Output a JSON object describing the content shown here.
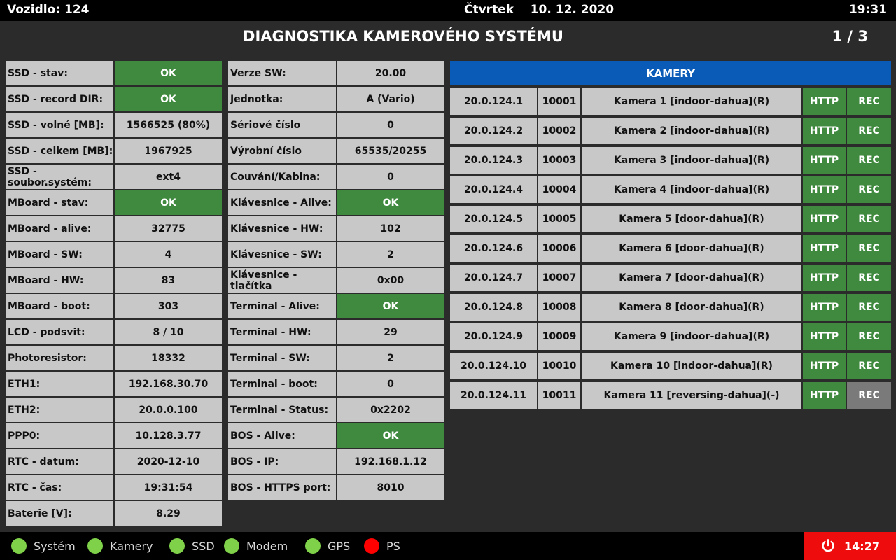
{
  "header": {
    "vehicle": "Vozidlo: 124",
    "day": "Čtvrtek",
    "date": "10. 12. 2020",
    "clock": "19:31"
  },
  "title": "DIAGNOSTIKA KAMEROVÉHO SYSTÉMU",
  "page": "1 / 3",
  "colors": {
    "ok": "#3f8a3f",
    "cell": "#c8c8c8",
    "header_blue": "#0a5bb8",
    "status_green": "#7fd14a",
    "status_red": "#ff0000",
    "power_red": "#ef0c0c",
    "rec_off": "#7a7a7a"
  },
  "col1": [
    {
      "label": "SSD - stav:",
      "value": "OK",
      "ok": true
    },
    {
      "label": "SSD - record DIR:",
      "value": "OK",
      "ok": true
    },
    {
      "label": "SSD - volné [MB]:",
      "value": "1566525 (80%)"
    },
    {
      "label": "SSD - celkem [MB]:",
      "value": "1967925"
    },
    {
      "label": "SSD - soubor.systém:",
      "value": "ext4"
    },
    {
      "label": "MBoard - stav:",
      "value": "OK",
      "ok": true
    },
    {
      "label": "MBoard - alive:",
      "value": "32775"
    },
    {
      "label": "MBoard - SW:",
      "value": "4"
    },
    {
      "label": "MBoard - HW:",
      "value": "83"
    },
    {
      "label": "MBoard - boot:",
      "value": "303"
    },
    {
      "label": "LCD - podsvit:",
      "value": "8 / 10"
    },
    {
      "label": "Photoresistor:",
      "value": "18332"
    },
    {
      "label": "ETH1:",
      "value": "192.168.30.70"
    },
    {
      "label": "ETH2:",
      "value": "20.0.0.100"
    },
    {
      "label": "PPP0:",
      "value": "10.128.3.77"
    },
    {
      "label": "RTC - datum:",
      "value": "2020-12-10"
    },
    {
      "label": "RTC - čas:",
      "value": "19:31:54"
    },
    {
      "label": "Baterie [V]:",
      "value": "8.29"
    }
  ],
  "col2": [
    {
      "label": "Verze SW:",
      "value": "20.00"
    },
    {
      "label": "Jednotka:",
      "value": "A (Vario)"
    },
    {
      "label": "Sériové číslo",
      "value": "0"
    },
    {
      "label": "Výrobní číslo",
      "value": "65535/20255"
    },
    {
      "label": "Couvání/Kabina:",
      "value": "0"
    },
    {
      "label": "Klávesnice - Alive:",
      "value": "OK",
      "ok": true
    },
    {
      "label": "Klávesnice - HW:",
      "value": "102"
    },
    {
      "label": "Klávesnice - SW:",
      "value": "2"
    },
    {
      "label": "Klávesnice - tlačítka",
      "value": "0x00"
    },
    {
      "label": "Terminal - Alive:",
      "value": "OK",
      "ok": true
    },
    {
      "label": "Terminal - HW:",
      "value": "29"
    },
    {
      "label": "Terminal - SW:",
      "value": "2"
    },
    {
      "label": "Terminal - boot:",
      "value": "0"
    },
    {
      "label": "Terminal - Status:",
      "value": "0x2202"
    },
    {
      "label": "BOS - Alive:",
      "value": "OK",
      "ok": true
    },
    {
      "label": "BOS - IP:",
      "value": "192.168.1.12"
    },
    {
      "label": "BOS - HTTPS port:",
      "value": "8010"
    }
  ],
  "cameras": {
    "header": "KAMERY",
    "http_label": "HTTP",
    "rec_label": "REC",
    "rows": [
      {
        "ip": "20.0.124.1",
        "port": "10001",
        "name": "Kamera 1 [indoor-dahua](R)",
        "rec_ok": true
      },
      {
        "ip": "20.0.124.2",
        "port": "10002",
        "name": "Kamera 2 [indoor-dahua](R)",
        "rec_ok": true
      },
      {
        "ip": "20.0.124.3",
        "port": "10003",
        "name": "Kamera 3 [indoor-dahua](R)",
        "rec_ok": true
      },
      {
        "ip": "20.0.124.4",
        "port": "10004",
        "name": "Kamera 4 [indoor-dahua](R)",
        "rec_ok": true
      },
      {
        "ip": "20.0.124.5",
        "port": "10005",
        "name": "Kamera 5 [door-dahua](R)",
        "rec_ok": true
      },
      {
        "ip": "20.0.124.6",
        "port": "10006",
        "name": "Kamera 6 [door-dahua](R)",
        "rec_ok": true
      },
      {
        "ip": "20.0.124.7",
        "port": "10007",
        "name": "Kamera 7 [door-dahua](R)",
        "rec_ok": true
      },
      {
        "ip": "20.0.124.8",
        "port": "10008",
        "name": "Kamera 8 [door-dahua](R)",
        "rec_ok": true
      },
      {
        "ip": "20.0.124.9",
        "port": "10009",
        "name": "Kamera 9 [indoor-dahua](R)",
        "rec_ok": true
      },
      {
        "ip": "20.0.124.10",
        "port": "10010",
        "name": "Kamera 10 [indoor-dahua](R)",
        "rec_ok": true
      },
      {
        "ip": "20.0.124.11",
        "port": "10011",
        "name": "Kamera 11 [reversing-dahua](-)",
        "rec_ok": false
      }
    ]
  },
  "status_bar": [
    {
      "label": "Systém",
      "state": "ok"
    },
    {
      "label": "Kamery",
      "state": "ok"
    },
    {
      "label": "SSD",
      "state": "ok"
    },
    {
      "label": "Modem",
      "state": "ok"
    },
    {
      "label": "GPS",
      "state": "ok"
    },
    {
      "label": "PS",
      "state": "error"
    }
  ],
  "power": {
    "icon": "power-icon",
    "time": "14:27"
  }
}
